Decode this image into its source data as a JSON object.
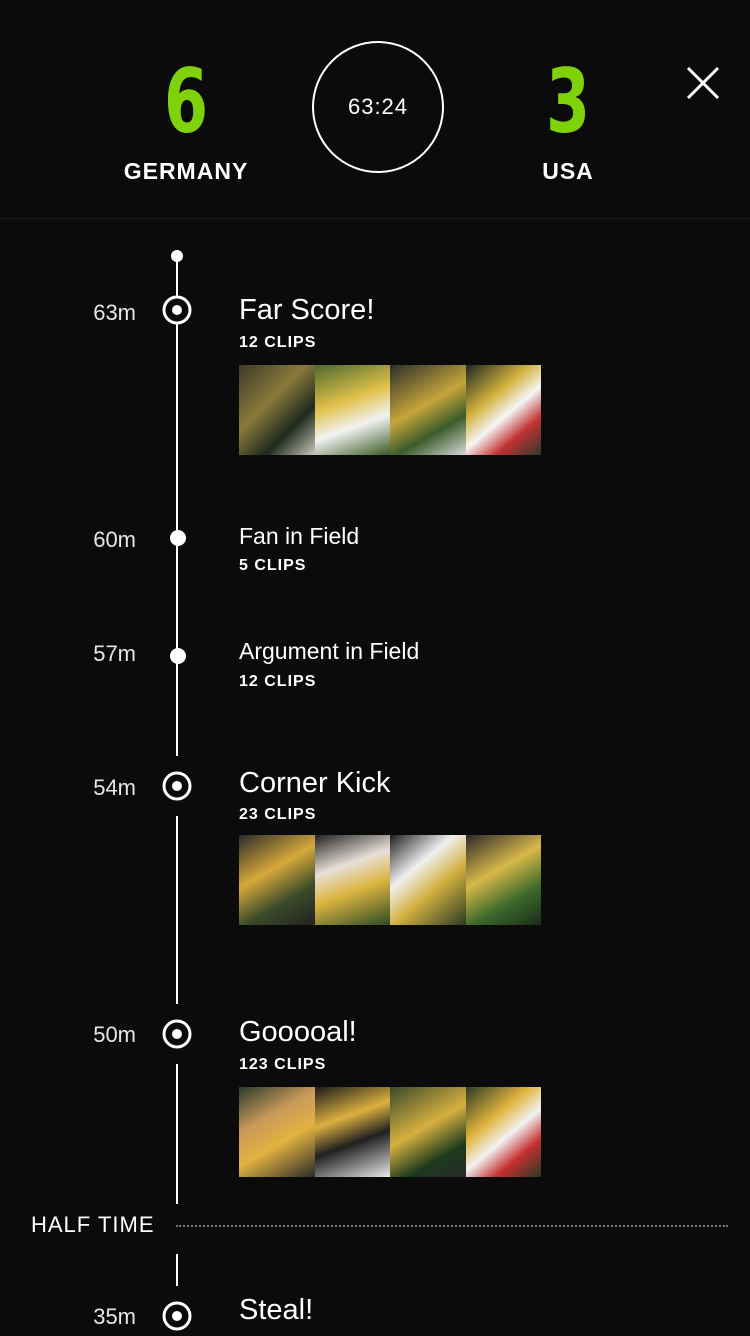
{
  "scoreboard": {
    "home_score": "6",
    "home_team": "GERMANY",
    "away_score": "3",
    "away_team": "USA",
    "clock": "63:24",
    "close_icon": "close-icon",
    "score_color": "#7fd10a"
  },
  "events": [
    {
      "time": "63m",
      "title": "Far Score!",
      "clips": "12 CLIPS",
      "marker": "target-icon"
    },
    {
      "time": "60m",
      "title": "Fan in Field",
      "clips": "5 CLIPS",
      "marker": "dot-icon"
    },
    {
      "time": "57m",
      "title": "Argument in Field",
      "clips": "12 CLIPS",
      "marker": "dot-icon"
    },
    {
      "time": "54m",
      "title": "Corner Kick",
      "clips": "23 CLIPS",
      "marker": "target-icon"
    },
    {
      "time": "50m",
      "title": "Gooooal!",
      "clips": "123 CLIPS",
      "marker": "target-icon"
    },
    {
      "time": "35m",
      "title": "Steal!",
      "marker": "target-icon"
    }
  ],
  "halftime": {
    "label": "HALF TIME"
  }
}
